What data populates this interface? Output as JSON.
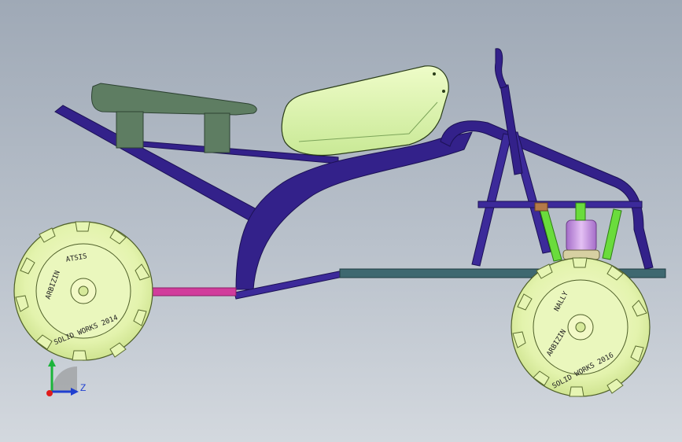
{
  "viewport": {
    "background_top": "#9fa9b6",
    "background_bottom": "#d3d8de"
  },
  "model": {
    "frame_color": "#33218a",
    "frame_highlight": "#5a49b8",
    "seat_color": "#5e7d62",
    "tank_color": "#d8f3a8",
    "tire_color": "#e8f7b8",
    "rim_color": "#f2f9c6",
    "axle_color": "#3e6870",
    "suspension_color": "#6adc3c",
    "damper_color": "#c58fe2",
    "pink_tube_color": "#d13c9c"
  },
  "tire_labels": {
    "rear_top": "ATSIS",
    "rear_bottom": "SOLID WORKS 2014",
    "rear_left": "ARBIZIN",
    "front_top": "NALLY",
    "front_middle": "ARBIZIN",
    "front_bottom": "SOLID WORKS 2016"
  },
  "triad": {
    "z_label": "Z"
  }
}
